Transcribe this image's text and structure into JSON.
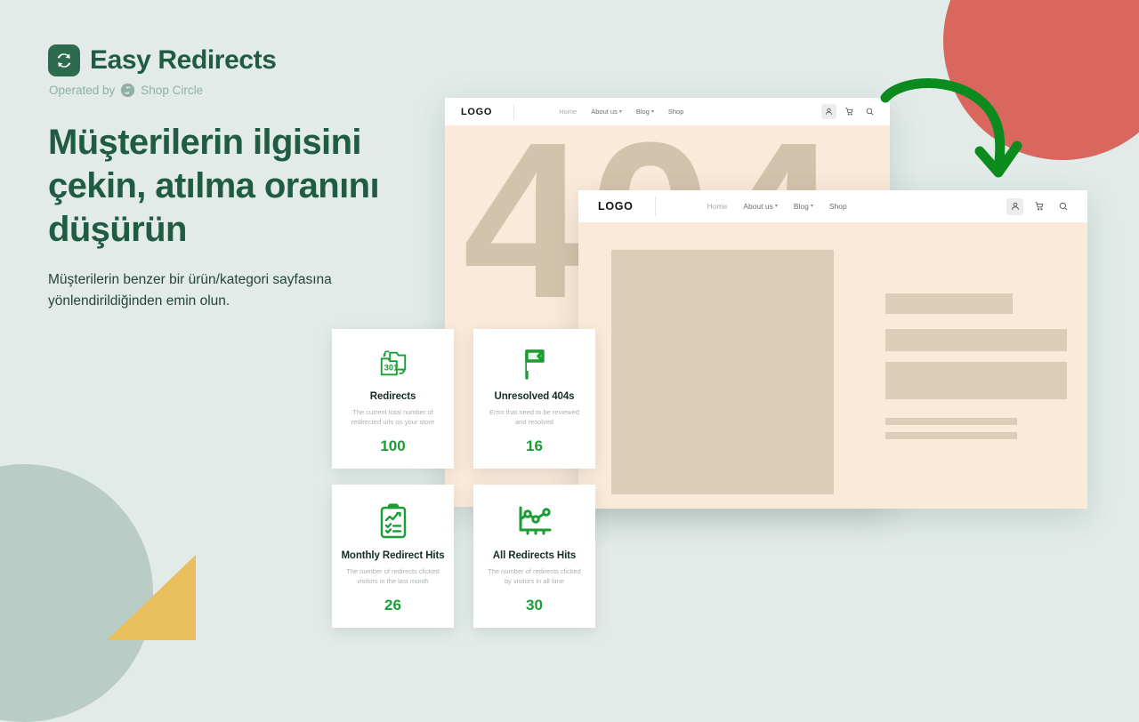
{
  "theme": {
    "background": "#e2ebe8",
    "brand_green": "#1f5c43",
    "accent_green": "#1a9e34",
    "arrow_green": "#0b8a1e",
    "coral": "#d9675e",
    "gold": "#e8bf5c",
    "sage": "#b9ccc6",
    "page_cream": "#fbeada",
    "placeholder_tan": "#ddcdb8"
  },
  "brand": {
    "logo_icon": "refresh-swirl-icon",
    "name": "Easy Redirects",
    "operated_by_label": "Operated by",
    "operator_icon": "shop-circle-icon",
    "operator_name": "Shop Circle"
  },
  "hero": {
    "headline": "Müşterilerin ilgisini çekin, atılma oranını düşürün",
    "subline": "Müşterilerin benzer bir ürün/kategori sayfasına yönlendirildiğinden emin olun."
  },
  "browser_back": {
    "logo": "LOGO",
    "nav_links": [
      {
        "label": "Home",
        "has_caret": false,
        "muted": true
      },
      {
        "label": "About us",
        "has_caret": true,
        "muted": false
      },
      {
        "label": "Blog",
        "has_caret": true,
        "muted": false
      },
      {
        "label": "Shop",
        "has_caret": false,
        "muted": false
      }
    ],
    "icons": [
      "account-icon",
      "cart-icon",
      "search-icon"
    ],
    "error_code": "404"
  },
  "browser_front": {
    "logo": "LOGO",
    "nav_links": [
      {
        "label": "Home",
        "has_caret": false,
        "muted": true
      },
      {
        "label": "About us",
        "has_caret": true,
        "muted": false
      },
      {
        "label": "Blog",
        "has_caret": true,
        "muted": false
      },
      {
        "label": "Shop",
        "has_caret": false,
        "muted": false
      }
    ],
    "icons": [
      "account-icon",
      "cart-icon",
      "search-icon"
    ]
  },
  "arrow": {
    "icon": "curved-arrow-down-icon",
    "color": "#0b8a1e"
  },
  "stat_cards": [
    {
      "icon": "redirect-301-documents-icon",
      "title": "Redirects",
      "description": "The current total number of redirected urls on your store",
      "value": "100"
    },
    {
      "icon": "flag-icon",
      "title": "Unresolved 404s",
      "description": "Error that need to be reviewed and resolved",
      "value": "16"
    },
    {
      "icon": "clipboard-chart-checklist-icon",
      "title": "Monthly Redirect Hits",
      "description": "The number of redirects clicked visitors in the last month",
      "value": "26"
    },
    {
      "icon": "line-chart-icon",
      "title": "All Redirects Hits",
      "description": "The number of redirects clicked by visitors in all time",
      "value": "30"
    }
  ]
}
